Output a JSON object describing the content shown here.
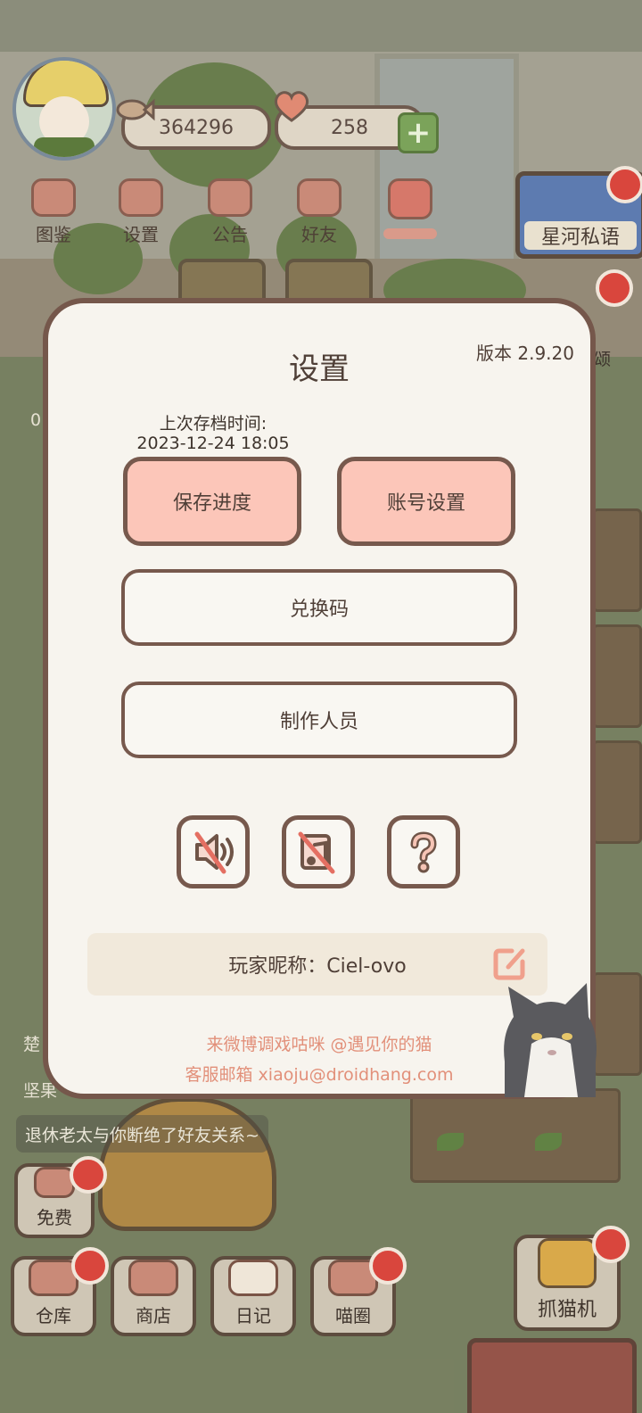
{
  "hud": {
    "fish_count": "364296",
    "heart_count": "258",
    "top_buttons": [
      {
        "label": "图鉴",
        "icon": "cat-face-icon"
      },
      {
        "label": "设置",
        "icon": "gear-icon"
      },
      {
        "label": "公告",
        "icon": "gift-icon"
      },
      {
        "label": "好友",
        "icon": "friends-icon"
      }
    ],
    "event_sign": "星河私语",
    "side_labels": [
      "0",
      "颂",
      "楚",
      "坚果"
    ],
    "toast": "退休老太与你断绝了好友关系~"
  },
  "settings": {
    "title": "设置",
    "version": "版本 2.9.20",
    "save_time_label": "上次存档时间:",
    "save_time_value": "2023-12-24 18:05",
    "save_button": "保存进度",
    "account_button": "账号设置",
    "redeem_button": "兑换码",
    "credits_button": "制作人员",
    "icon_buttons": [
      {
        "name": "sound-muted-icon"
      },
      {
        "name": "music-muted-icon"
      },
      {
        "name": "help-icon"
      }
    ],
    "nickname_label": "玩家昵称：",
    "nickname_value": "Ciel-ovo",
    "nickname_display": "玩家昵称：Ciel-ovo",
    "weibo_line": "来微博调戏咕咪 @遇见你的猫",
    "email_line": "客服邮箱 xiaoju@droidhang.com"
  },
  "bottom_bar": {
    "free_label": "免费",
    "warehouse_label": "仓库",
    "shop_label": "商店",
    "diary_label": "日记",
    "meow_circle_label": "喵圈",
    "claw_machine_label": "抓猫机"
  },
  "colors": {
    "modal_bg": "#f7f4ee",
    "modal_border": "#75574b",
    "primary_button": "#fcc6b9",
    "accent_text": "#e2907a",
    "notification_dot": "#d9463d"
  }
}
